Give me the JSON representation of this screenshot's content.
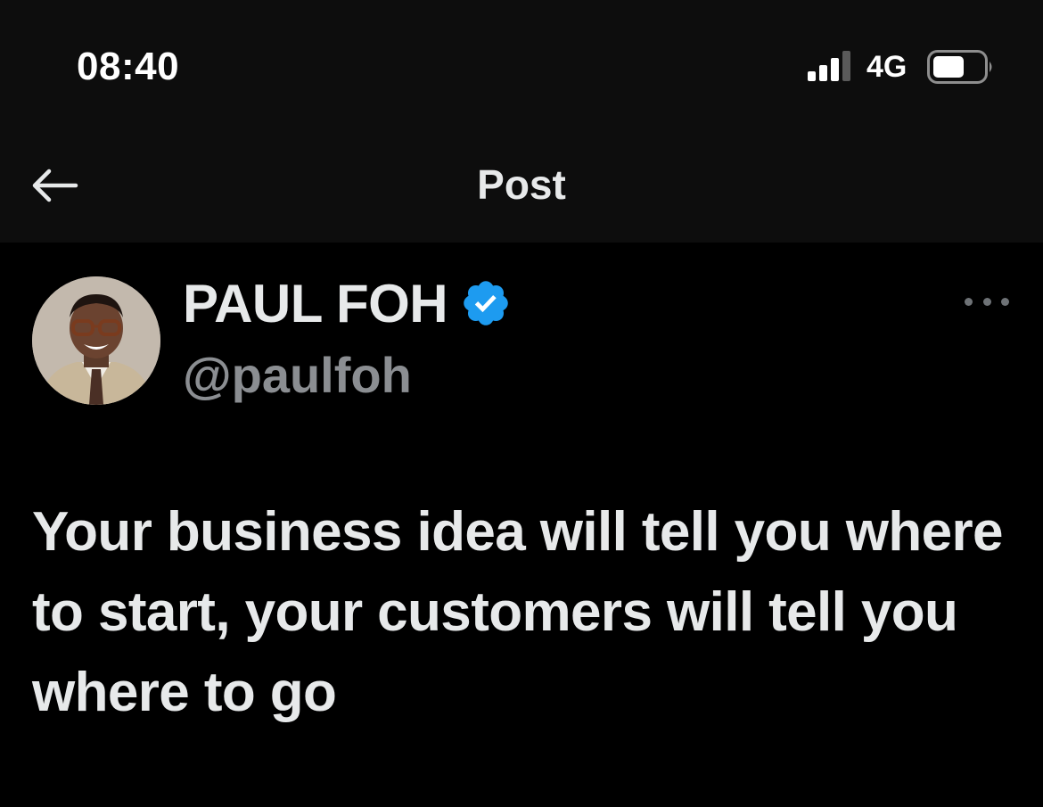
{
  "status_bar": {
    "time": "08:40",
    "network": "4G",
    "signal_icon": "cellular-signal-icon",
    "battery_icon": "battery-icon"
  },
  "nav": {
    "back_icon": "arrow-left-icon",
    "title": "Post"
  },
  "post": {
    "author": {
      "display_name": "PAUL FOH",
      "handle": "@paulfoh",
      "verified": true,
      "verified_icon": "verified-badge-icon"
    },
    "more_icon": "more-horizontal-icon",
    "text": "Your business idea will tell you where to start, your customers will tell you where to go"
  },
  "colors": {
    "background": "#000000",
    "chrome_background": "#0d0d0d",
    "text_primary": "#e7e9ea",
    "text_secondary": "#8b8e92",
    "verified_blue": "#1d9bf0"
  }
}
